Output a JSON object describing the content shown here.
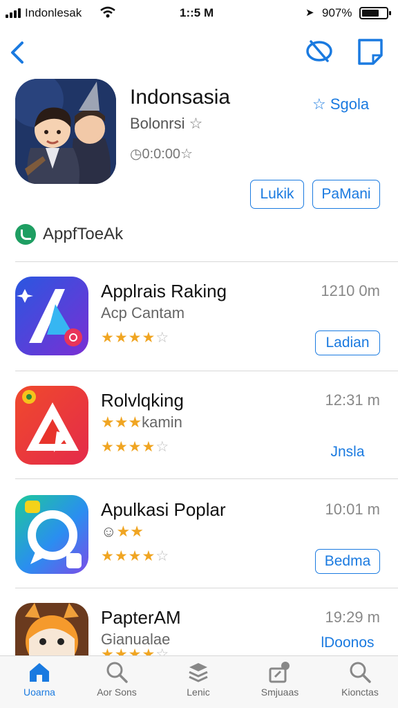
{
  "status_bar": {
    "carrier": "Indonlesak",
    "time": "1::5 M",
    "battery": "907%"
  },
  "header": {
    "app_title": "Indonsasia",
    "app_subtitle": "Bolonrsi",
    "rating_text": "0:0:00",
    "favorite_label": "Sgola",
    "buttons": [
      {
        "label": "Lukik"
      },
      {
        "label": "PaMani"
      }
    ]
  },
  "section": {
    "title": "AppfToeAk"
  },
  "apps": [
    {
      "name": "Applrais Raking",
      "category": "Acp Cantam",
      "time": "1210 0m",
      "rating": 4,
      "action": "Ladian",
      "action_style": "outlined"
    },
    {
      "name": "Rolvlqking",
      "category": "kamin",
      "time": "12:31 m",
      "rating": 4,
      "action": "Jnsla",
      "action_style": "plain"
    },
    {
      "name": "Apulkasi Poplar",
      "category": "",
      "time": "10:01 m",
      "rating": 4,
      "action": "Bedma",
      "action_style": "outlined"
    },
    {
      "name": "PapterAM",
      "category": "Gianualae",
      "time": "19:29 m",
      "rating": 4,
      "action": "lDoonos",
      "action_style": "plain"
    }
  ],
  "tabbar": {
    "tabs": [
      {
        "label": "Uoarna",
        "icon": "home-icon",
        "active": true
      },
      {
        "label": "Aor Sons",
        "icon": "search-icon",
        "active": false
      },
      {
        "label": "Lenic",
        "icon": "stack-icon",
        "active": false
      },
      {
        "label": "Smjuaas",
        "icon": "updates-icon",
        "active": false
      },
      {
        "label": "Kionctas",
        "icon": "search-icon",
        "active": false
      }
    ]
  },
  "colors": {
    "accent": "#1a7ae0",
    "star": "#f0a522",
    "section_badge": "#1e9e62"
  }
}
